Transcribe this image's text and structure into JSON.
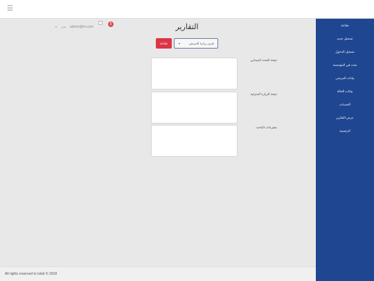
{
  "topbar": {
    "menu_icon": "hamburger-icon",
    "menu_glyph": "☰"
  },
  "sidebar": {
    "items": [
      {
        "label": "طباعة"
      },
      {
        "label": "تسجيل جديد"
      },
      {
        "label": "تسجيل الدخول"
      },
      {
        "label": "بحث في المؤسسة"
      },
      {
        "label": "بيانات المرضى"
      },
      {
        "label": "بيانات الحالة"
      },
      {
        "label": "الخدمات"
      },
      {
        "label": "عرض التقارير"
      },
      {
        "label": "الرئيسية"
      }
    ],
    "background": "#1f4690"
  },
  "header": {
    "user_role": "مدير",
    "user_email": "admin@m.com",
    "notification_count": "5",
    "caret": "▾"
  },
  "main": {
    "title": "التقارير",
    "print_button": "طباعة",
    "report_select": {
      "value": "تقرير زيارة المريض",
      "caret": "▾"
    },
    "fields": [
      {
        "label": "نتيجة البحث الميداني",
        "value": ""
      },
      {
        "label": "نتيجة الزيارة المنزلية",
        "value": ""
      },
      {
        "label": "مقترحات الباحث",
        "value": ""
      }
    ]
  },
  "footer": {
    "text": "All rights reserved to Islah © 2018"
  },
  "colors": {
    "accent": "#dc3545",
    "sidebar": "#1f4690",
    "background": "#e8e8e9"
  }
}
